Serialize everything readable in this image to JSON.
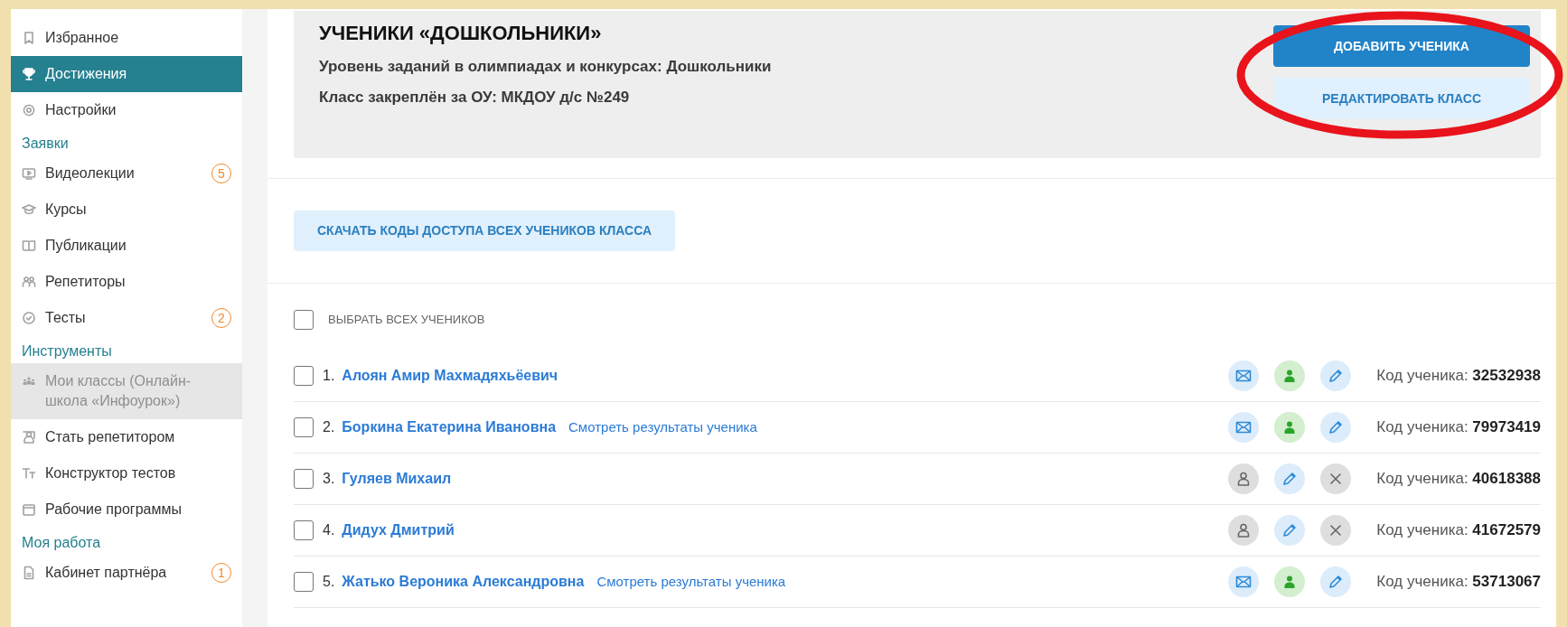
{
  "sidebar": {
    "top_items": [
      {
        "label": "Избранное",
        "selected": false,
        "disabled": false
      },
      {
        "label": "Достижения",
        "selected": true,
        "disabled": false
      },
      {
        "label": "Настройки",
        "selected": false,
        "disabled": false
      }
    ],
    "sections": [
      {
        "heading": "Заявки",
        "items": [
          {
            "label": "Видеолекции",
            "badge": "5",
            "selected": false,
            "disabled": false
          },
          {
            "label": "Курсы",
            "selected": false,
            "disabled": false
          },
          {
            "label": "Публикации",
            "selected": false,
            "disabled": false
          },
          {
            "label": "Репетиторы",
            "selected": false,
            "disabled": false
          },
          {
            "label": "Тесты",
            "badge": "2",
            "selected": false,
            "disabled": false
          }
        ]
      },
      {
        "heading": "Инструменты",
        "items": [
          {
            "label": "Мои классы (Онлайн-школа «Инфоурок»)",
            "selected": false,
            "disabled": true
          },
          {
            "label": "Стать репетитором",
            "selected": false,
            "disabled": false
          },
          {
            "label": "Конструктор тестов",
            "selected": false,
            "disabled": false
          },
          {
            "label": "Рабочие программы",
            "selected": false,
            "disabled": false
          }
        ]
      },
      {
        "heading": "Моя работа",
        "items": [
          {
            "label": "Кабинет партнёра",
            "badge": "1",
            "selected": false,
            "disabled": false
          }
        ]
      }
    ]
  },
  "header": {
    "title": "УЧЕНИКИ «ДОШКОЛЬНИКИ»",
    "lines": [
      "Уровень заданий в олимпиадах и конкурсах: Дошкольники",
      "Класс закреплён за ОУ: МКДОУ д/с №249"
    ],
    "primary_button": "ДОБАВИТЬ УЧЕНИКА",
    "secondary_button": "РЕДАКТИРОВАТЬ КЛАСС"
  },
  "download_button": "СКАЧАТЬ КОДЫ ДОСТУПА ВСЕХ УЧЕНИКОВ КЛАССА",
  "select_all": {
    "label": "ВЫБРАТЬ ВСЕХ УЧЕНИКОВ",
    "checked": false
  },
  "students": [
    {
      "number": "1.",
      "name": "Алоян Амир Махмадяхьёевич",
      "kind": "active",
      "checked": false,
      "code_label": "Код ученика:",
      "code": "32532938"
    },
    {
      "number": "2.",
      "name": "Боркина Екатерина Ивановна",
      "results_link": "Смотреть результаты ученика",
      "kind": "active",
      "checked": false,
      "code_label": "Код ученика:",
      "code": "79973419"
    },
    {
      "number": "3.",
      "name": "Гуляев Михаил",
      "kind": "inactive",
      "checked": false,
      "code_label": "Код ученика:",
      "code": "40618388"
    },
    {
      "number": "4.",
      "name": "Дидух Дмитрий",
      "kind": "inactive",
      "checked": false,
      "code_label": "Код ученика:",
      "code": "41672579"
    },
    {
      "number": "5.",
      "name": "Жатько Вероника Александровна",
      "results_link": "Смотреть результаты ученика",
      "kind": "active",
      "checked": false,
      "code_label": "Код ученика:",
      "code": "53713067"
    }
  ]
}
